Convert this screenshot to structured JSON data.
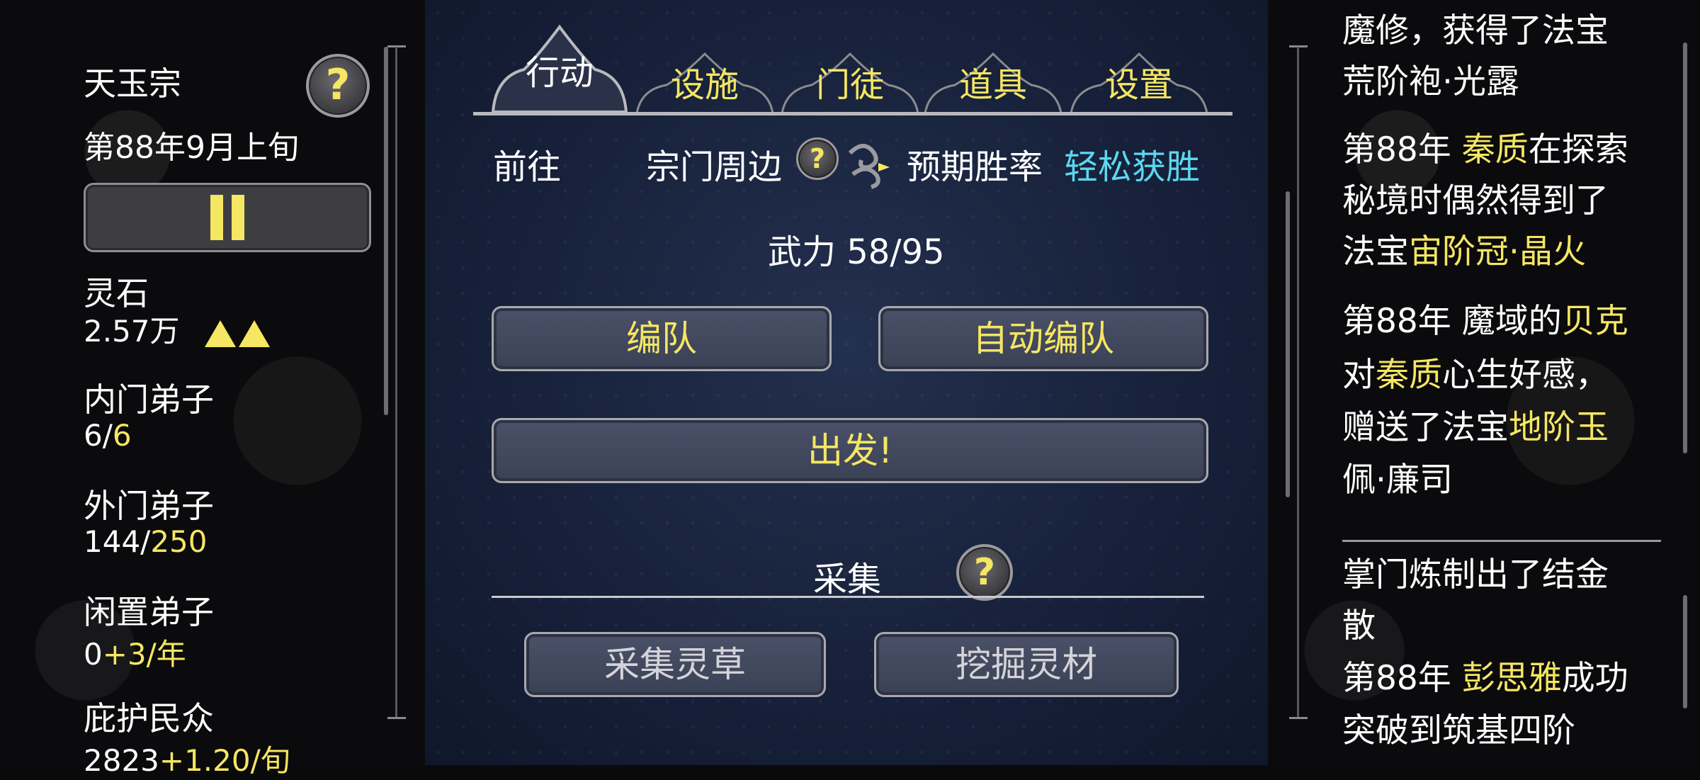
{
  "sidebar": {
    "sect_name": "天玉宗",
    "date": "第88年9月上旬",
    "stats": [
      {
        "label": "灵石",
        "value_white": "2.57万",
        "value_yellow": ""
      },
      {
        "label": "内门弟子",
        "value_white": "6/",
        "value_yellow": "6"
      },
      {
        "label": "外门弟子",
        "value_white": "144/",
        "value_yellow": "250"
      },
      {
        "label": "闲置弟子",
        "value_white": "0",
        "value_yellow": "+3/年"
      },
      {
        "label": "庇护民众",
        "value_white": "2823",
        "value_yellow": "+1.20/旬"
      }
    ]
  },
  "tabs": [
    {
      "label": "行动",
      "active": true
    },
    {
      "label": "设施"
    },
    {
      "label": "门徒"
    },
    {
      "label": "道具"
    },
    {
      "label": "设置"
    }
  ],
  "action": {
    "go_label": "前往",
    "destination": "宗门周边",
    "win_rate_label": "预期胜率",
    "win_rate_value": "轻松获胜",
    "force_label": "武力 58/95",
    "formation_button": "编队",
    "auto_formation_button": "自动编队",
    "depart_button": "出发!",
    "gather_title": "采集",
    "gather_herbs_button": "采集灵草",
    "dig_materials_button": "挖掘灵材"
  },
  "log": {
    "line1": "魔修，获得了法宝",
    "line2": "荒阶袍·光露",
    "e1_l1_a": "第88年 ",
    "e1_l1_b": "秦质",
    "e1_l1_c": "在探索",
    "e1_l2": "秘境时偶然得到了",
    "e1_l3_a": "法宝",
    "e1_l3_b": "宙阶冠·晶火",
    "e2_l1_a": "第88年 魔域的",
    "e2_l1_b": "贝克",
    "e2_l2_a": "对",
    "e2_l2_b": "秦质",
    "e2_l2_c": "心生好感，",
    "e2_l3_a": "赠送了法宝",
    "e2_l3_b": "地阶玉",
    "e2_l4": "佩·廉司",
    "e3_l1": "掌门炼制出了结金",
    "e3_l2": "散",
    "e4_l1_a": "第88年 ",
    "e4_l1_b": "彭思雅",
    "e4_l1_c": "成功",
    "e4_l2": "突破到筑基四阶"
  },
  "colors": {
    "accent_yellow": "#f5e663",
    "accent_cyan": "#5cd7f0"
  },
  "icons": [
    "help-icon",
    "pause-icon",
    "up-arrows-icon",
    "cloud-swirl-icon"
  ]
}
